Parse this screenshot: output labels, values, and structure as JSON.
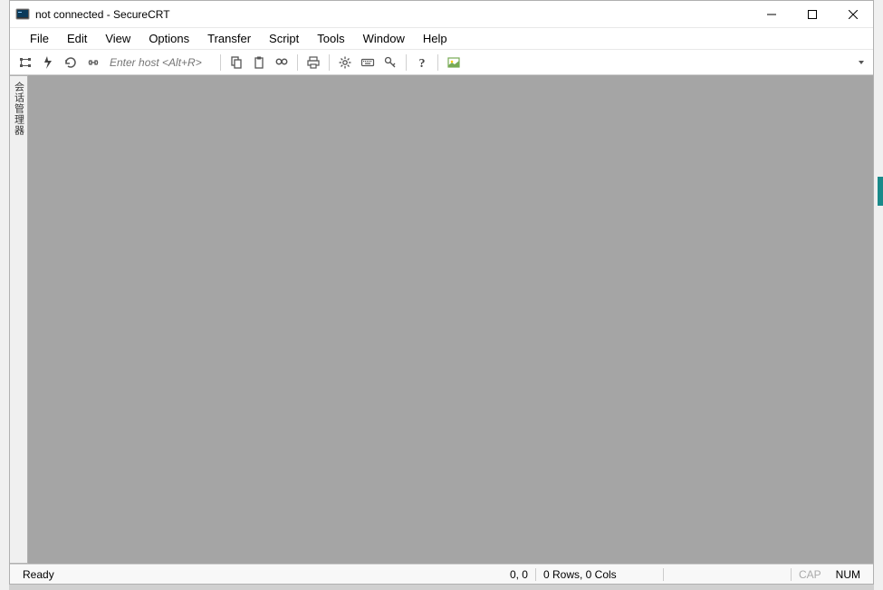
{
  "window": {
    "title": "not connected - SecureCRT"
  },
  "menu": {
    "items": [
      "File",
      "Edit",
      "View",
      "Options",
      "Transfer",
      "Script",
      "Tools",
      "Window",
      "Help"
    ]
  },
  "toolbar": {
    "host_placeholder": "Enter host <Alt+R>",
    "icons": {
      "session_manager": "session-manager-icon",
      "quick_connect": "quick-connect-icon",
      "reconnect": "reconnect-icon",
      "disconnect": "disconnect-icon",
      "copy": "copy-icon",
      "paste": "paste-icon",
      "find": "find-icon",
      "print": "print-icon",
      "settings": "settings-icon",
      "keyboard": "keyboard-icon",
      "key": "key-icon",
      "help": "help-icon",
      "screenshot": "screenshot-icon"
    }
  },
  "side_panel": {
    "label": "会话管理器"
  },
  "status": {
    "ready": "Ready",
    "cursor": "0, 0",
    "dims": "0 Rows, 0 Cols",
    "cap": "CAP",
    "num": "NUM"
  }
}
